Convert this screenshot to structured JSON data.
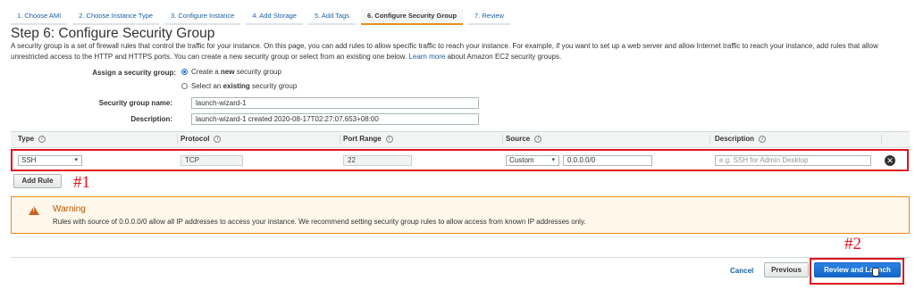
{
  "wizard": {
    "steps": [
      "1. Choose AMI",
      "2. Choose Instance Type",
      "3. Configure Instance",
      "4. Add Storage",
      "5. Add Tags",
      "6. Configure Security Group",
      "7. Review"
    ],
    "active_index": 5
  },
  "page": {
    "title": "Step 6: Configure Security Group",
    "intro": "A security group is a set of firewall rules that control the traffic for your instance. On this page, you can add rules to allow specific traffic to reach your instance. For example, if you want to set up a web server and allow Internet traffic to reach your instance, add rules that allow unrestricted access to the HTTP and HTTPS ports. You can create a new security group or select from an existing one below.",
    "learn_more": "Learn more",
    "intro_tail": "about Amazon EC2 security groups."
  },
  "assign": {
    "label": "Assign a security group:",
    "option_create_pre": "Create a ",
    "option_create_bold": "new",
    "option_create_post": " security group",
    "option_existing_pre": "Select an ",
    "option_existing_bold": "existing",
    "option_existing_post": " security group",
    "selected": "create"
  },
  "form": {
    "name_label": "Security group name:",
    "name_value": "launch-wizard-1",
    "desc_label": "Description:",
    "desc_value": "launch-wizard-1 created 2020-08-17T02:27:07.653+08:00"
  },
  "table": {
    "headers": {
      "type": "Type",
      "protocol": "Protocol",
      "port_range": "Port Range",
      "source": "Source",
      "description": "Description"
    },
    "info_glyph": "i",
    "row": {
      "type": "SSH",
      "protocol": "TCP",
      "port_range": "22",
      "source_mode": "Custom",
      "source_cidr": "0.0.0.0/0",
      "description_placeholder": "e.g. SSH for Admin Desktop"
    }
  },
  "buttons": {
    "add_rule": "Add Rule",
    "cancel": "Cancel",
    "previous": "Previous",
    "review_launch": "Review and Launch",
    "remove_glyph": "✕",
    "caret": "▾"
  },
  "annotations": {
    "first": "#1",
    "second": "#2"
  },
  "warning": {
    "title": "Warning",
    "icon_glyph": "!",
    "text": "Rules with source of 0.0.0.0/0 allow all IP addresses to access your instance. We recommend setting security group rules to allow access from known IP addresses only."
  },
  "colors": {
    "accent": "#1a5fa6",
    "primary": "#1466c6",
    "highlight": "#e0131f",
    "warning": "#e88d1b"
  },
  "icons": [
    "info-icon",
    "remove-icon",
    "warning-icon",
    "dropdown-caret-icon",
    "mouse-cursor-icon"
  ]
}
